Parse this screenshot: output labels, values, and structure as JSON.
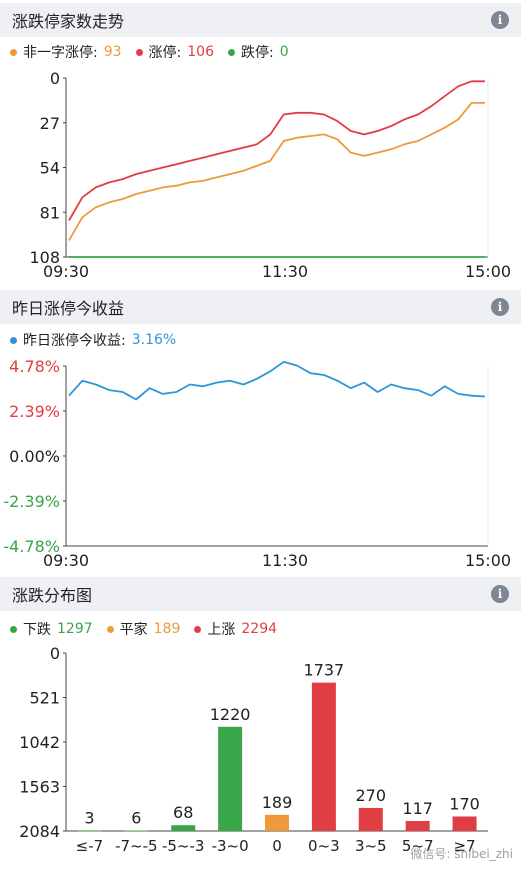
{
  "colors": {
    "orange": "#ee9a3a",
    "red": "#e03e43",
    "green": "#3aa64a",
    "blue": "#2e96d6",
    "axisRed": "#e03e43",
    "axisGreen": "#3aa64a"
  },
  "panel1": {
    "title": "涨跌停家数走势",
    "legend": [
      {
        "label": "非一字涨停:",
        "value": "93",
        "color": "#ee9a3a"
      },
      {
        "label": "涨停:",
        "value": "106",
        "color": "#e03e43"
      },
      {
        "label": "跌停:",
        "value": "0",
        "color": "#3aa64a"
      }
    ]
  },
  "panel2": {
    "title": "昨日涨停今收益",
    "legend": [
      {
        "label": "昨日涨停今收益:",
        "value": "3.16%",
        "color": "#2e96d6"
      }
    ]
  },
  "panel3": {
    "title": "涨跌分布图",
    "legend": [
      {
        "label": "下跌",
        "value": "1297",
        "color": "#3aa64a"
      },
      {
        "label": "平家",
        "value": "189",
        "color": "#ee9a3a"
      },
      {
        "label": "上涨",
        "value": "2294",
        "color": "#e03e43"
      }
    ]
  },
  "watermark": "微信号: shibei_zhi",
  "chart_data": [
    {
      "type": "line",
      "title": "涨跌停家数走势",
      "x_ticks": [
        "09:30",
        "11:30",
        "15:00"
      ],
      "ylim": [
        0,
        108
      ],
      "y_ticks": [
        "0",
        "27",
        "54",
        "81",
        "108"
      ],
      "series": [
        {
          "name": "非一字涨停",
          "color": "#ee9a3a",
          "values": [
            10,
            24,
            30,
            33,
            35,
            38,
            40,
            42,
            43,
            45,
            46,
            48,
            50,
            52,
            55,
            58,
            70,
            72,
            73,
            74,
            71,
            63,
            61,
            63,
            65,
            68,
            70,
            74,
            78,
            83,
            93,
            93
          ]
        },
        {
          "name": "涨停",
          "color": "#e03e43",
          "values": [
            22,
            36,
            42,
            45,
            47,
            50,
            52,
            54,
            56,
            58,
            60,
            62,
            64,
            66,
            68,
            74,
            86,
            87,
            87,
            86,
            82,
            76,
            74,
            76,
            79,
            83,
            86,
            91,
            97,
            103,
            106,
            106
          ]
        },
        {
          "name": "跌停",
          "color": "#3aa64a",
          "values": [
            0,
            0,
            0,
            0,
            0,
            0,
            0,
            0,
            0,
            0,
            0,
            0,
            0,
            0,
            0,
            0,
            0,
            0,
            0,
            0,
            0,
            0,
            0,
            0,
            0,
            0,
            0,
            0,
            0,
            0,
            0,
            0
          ]
        }
      ]
    },
    {
      "type": "line",
      "title": "昨日涨停今收益",
      "x_ticks": [
        "09:30",
        "11:30",
        "15:00"
      ],
      "ylim": [
        -4.78,
        4.78
      ],
      "y_ticks": [
        "4.78%",
        "2.39%",
        "0.00%",
        "-2.39%",
        "-4.78%"
      ],
      "series": [
        {
          "name": "昨日涨停今收益",
          "color": "#2e96d6",
          "values": [
            3.2,
            4.0,
            3.8,
            3.5,
            3.4,
            3.0,
            3.6,
            3.3,
            3.4,
            3.8,
            3.7,
            3.9,
            4.0,
            3.8,
            4.1,
            4.5,
            5.0,
            4.8,
            4.4,
            4.3,
            4.0,
            3.6,
            3.9,
            3.4,
            3.8,
            3.6,
            3.5,
            3.2,
            3.7,
            3.3,
            3.2,
            3.16
          ]
        }
      ]
    },
    {
      "type": "bar",
      "title": "涨跌分布图",
      "categories": [
        "≤-7",
        "-7~-5",
        "-5~-3",
        "-3~0",
        "0",
        "0~3",
        "3~5",
        "5~7",
        "≥7"
      ],
      "values": [
        3,
        6,
        68,
        1220,
        189,
        1737,
        270,
        117,
        170
      ],
      "colors": [
        "#3aa64a",
        "#3aa64a",
        "#3aa64a",
        "#3aa64a",
        "#ee9a3a",
        "#e03e43",
        "#e03e43",
        "#e03e43",
        "#e03e43"
      ],
      "ylim": [
        0,
        2084
      ],
      "y_ticks": [
        "0",
        "521",
        "1042",
        "1563",
        "2084"
      ]
    }
  ]
}
